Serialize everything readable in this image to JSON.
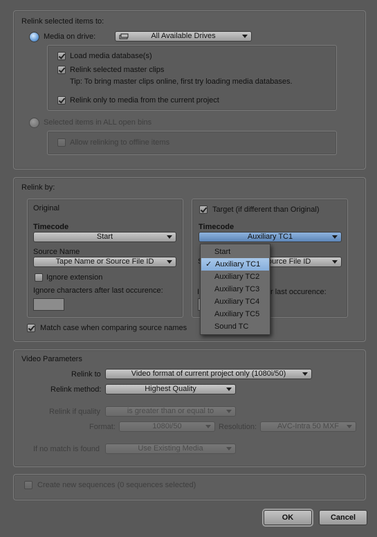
{
  "relink_to": {
    "title": "Relink selected items to:",
    "media_on_drive_label": "Media on drive:",
    "drive_dropdown": "All Available Drives",
    "load_media_database": "Load media database(s)",
    "relink_master_clips": "Relink selected master clips",
    "tip": "Tip: To bring master clips online, first try loading media databases.",
    "relink_current_project": "Relink only to media from the current project",
    "selected_items_all_bins": "Selected items in ALL open bins",
    "allow_relinking_offline": "Allow relinking to offline items"
  },
  "relink_by": {
    "title": "Relink by:",
    "original": {
      "title": "Original",
      "timecode_label": "Timecode",
      "timecode_value": "Start",
      "source_name_label": "Source Name",
      "source_name_value": "Tape Name or Source File ID",
      "ignore_extension": "Ignore extension",
      "ignore_chars_label": "Ignore characters after last occurence:"
    },
    "target": {
      "checkbox_label": "Target (if different than Original)",
      "timecode_label": "Timecode",
      "timecode_value": "Auxiliary TC1",
      "source_name_partial": "S",
      "source_name_value_partial": "ource File ID",
      "ignore_chars_partial_prefix": "I",
      "ignore_chars_partial": "r last occurence:"
    },
    "match_case": "Match case when comparing source names",
    "timecode_menu": {
      "items": [
        "Start",
        "Auxiliary TC1",
        "Auxiliary TC2",
        "Auxiliary TC3",
        "Auxiliary TC4",
        "Auxiliary TC5",
        "Sound TC"
      ],
      "selected": "Auxiliary TC1",
      "check_glyph": "✓"
    }
  },
  "video_parameters": {
    "title": "Video Parameters",
    "relink_to_label": "Relink to",
    "relink_to_value": "Video format of current project only  (1080i/50)",
    "relink_method_label": "Relink method:",
    "relink_method_value": "Highest Quality",
    "relink_if_quality_label": "Relink if quality",
    "relink_if_quality_value": "is greater than or equal to",
    "format_label": "Format:",
    "format_value": "1080i/50",
    "resolution_label": "Resolution:",
    "resolution_value": "AVC-Intra 50  MXF",
    "if_no_match_label": "If no match is found",
    "if_no_match_value": "Use Existing Media"
  },
  "create_sequences": "Create new sequences  (0 sequences selected)",
  "buttons": {
    "ok": "OK",
    "cancel": "Cancel"
  }
}
